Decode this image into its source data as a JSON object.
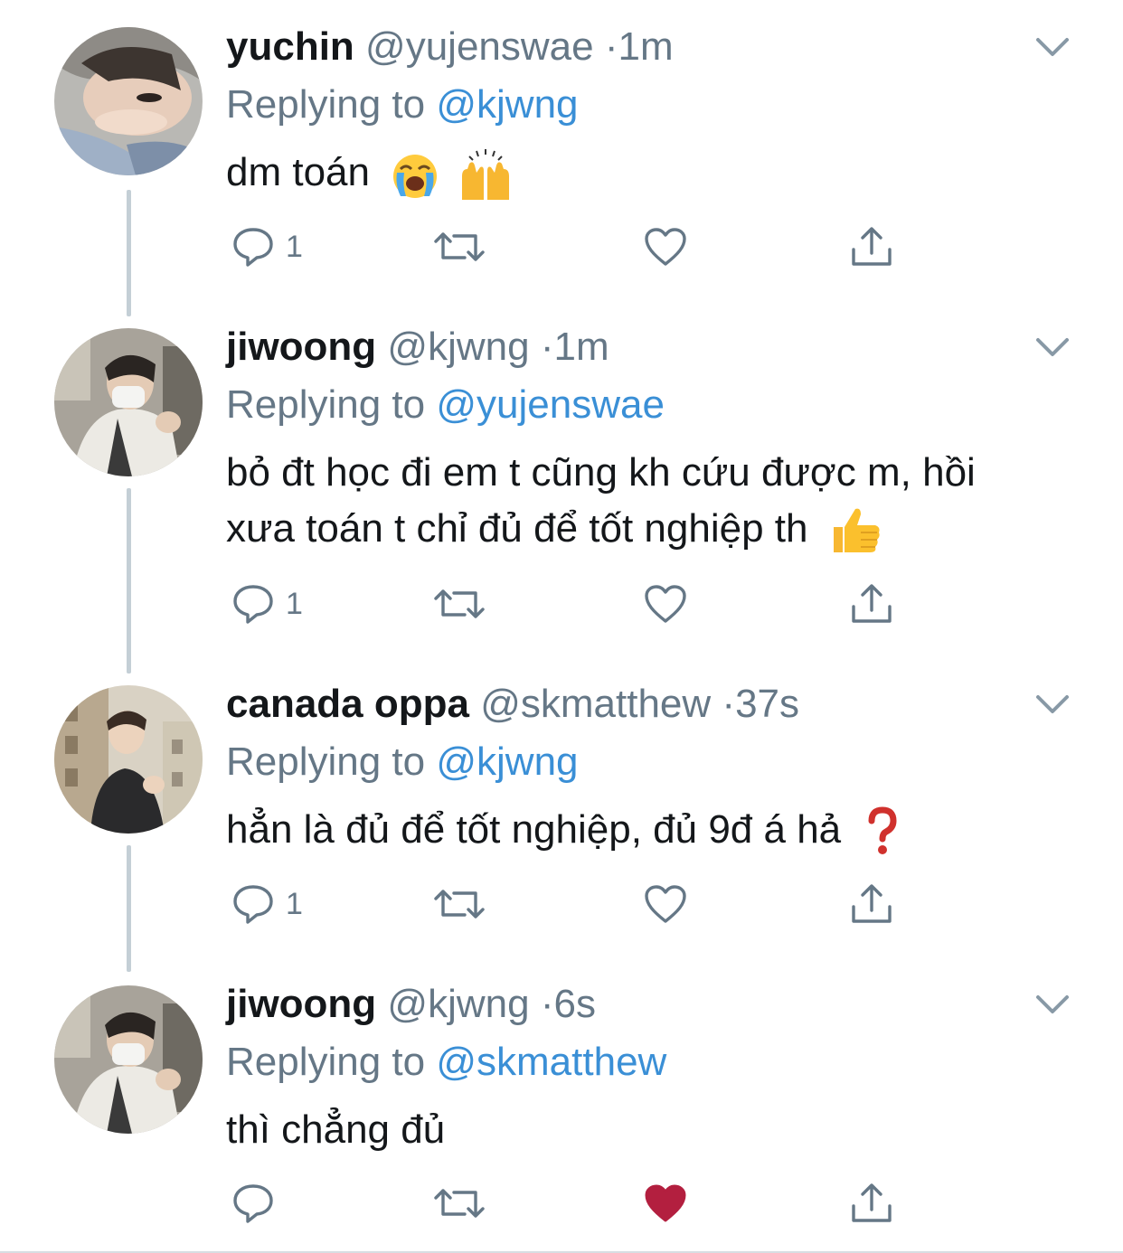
{
  "tweets": [
    {
      "name": "yuchin",
      "handle": "@yujenswae",
      "dot": "·",
      "time": "1m",
      "replying_prefix": "Replying to ",
      "replying_to": "@kjwng",
      "text": "dm toán",
      "emojis": [
        "loudly-crying-face",
        "raising-hands"
      ],
      "reply_count": "1",
      "liked": false
    },
    {
      "name": "jiwoong",
      "handle": "@kjwng",
      "dot": "·",
      "time": "1m",
      "replying_prefix": "Replying to ",
      "replying_to": "@yujenswae",
      "text_line1": "bỏ đt học đi em t cũng kh cứu được m, hồi",
      "text_line2": "xưa toán t chỉ đủ để tốt nghiệp th",
      "emojis": [
        "thumbs-up"
      ],
      "reply_count": "1",
      "liked": false
    },
    {
      "name": "canada oppa",
      "handle": "@skmatthew",
      "dot": "·",
      "time": "37s",
      "replying_prefix": "Replying to ",
      "replying_to": "@kjwng",
      "text": "hẳn là đủ để tốt nghiệp, đủ 9đ á hả",
      "emojis": [
        "red-question-mark"
      ],
      "reply_count": "1",
      "liked": false
    },
    {
      "name": "jiwoong",
      "handle": "@kjwng",
      "dot": "·",
      "time": "6s",
      "replying_prefix": "Replying to ",
      "replying_to": "@skmatthew",
      "text": "thì chẳng đủ",
      "reply_count": "",
      "liked": true
    }
  ],
  "colors": {
    "text": "#14171a",
    "secondary": "#657786",
    "link": "#3a8fd6",
    "thread_line": "#c4cfd6",
    "liked_heart": "#b31f3f"
  }
}
